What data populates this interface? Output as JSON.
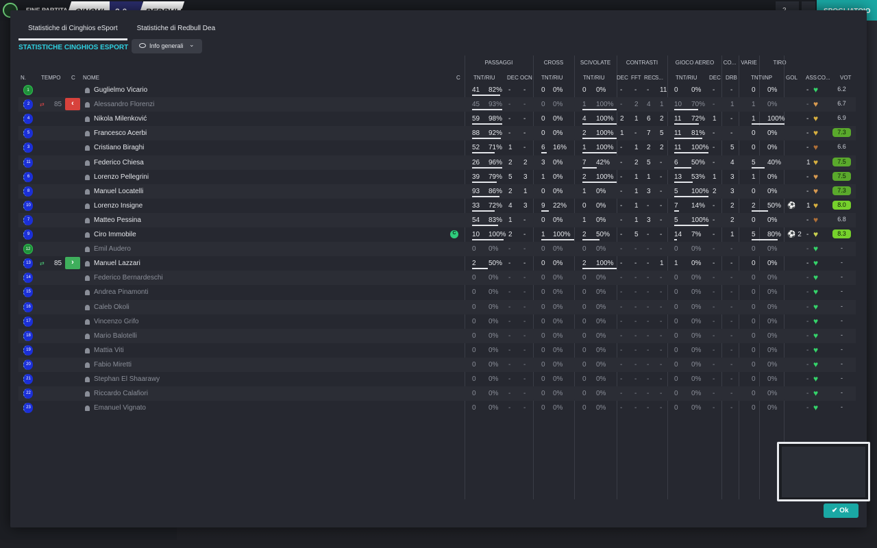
{
  "topbar": {
    "title": "FINE PARTITA",
    "team1": "CINGHI...",
    "score": "2-0",
    "team2": "REDBULL",
    "btn1": "2",
    "cta": "SPOGLIATOIO"
  },
  "modal": {
    "tabs": [
      "Statistiche di Cinghios eSport",
      "Statistiche di Redbull Dea"
    ],
    "section_title": "STATISTICHE CINGHIOS ESPORT",
    "dropdown": "Info generali",
    "ok_label": "Ok"
  },
  "headers": {
    "groups": [
      "PASSAGGI",
      "CROSS",
      "SCIVOLATE",
      "CONTRASTI",
      "GIOCO AEREO",
      "CO...",
      "VARIE",
      "TIRO"
    ],
    "cols": [
      "N.",
      "TEMPO",
      "C",
      "NOME",
      "C",
      "TNT/RIU",
      "DEC",
      "OCN",
      "TNT/RIU",
      "TNT/RIU",
      "DEC",
      "FFT",
      "REC",
      "S...",
      "TNT/RIU",
      "DEC",
      "DRB",
      "TNT\\INP",
      "GOL",
      "ASS",
      "CO...",
      "VOT"
    ]
  },
  "players": [
    {
      "n": "1",
      "name": "Guglielmo Vicario",
      "gk": true,
      "p": [
        "41",
        "82%"
      ],
      "dec": "-",
      "ocn": "-",
      "cr": [
        "0",
        "0%"
      ],
      "sc": [
        "0",
        "0%"
      ],
      "ct": [
        "-",
        "-",
        "-",
        "11"
      ],
      "ga": [
        "0",
        "0%"
      ],
      "co": "-",
      "drb": "-",
      "sh": [
        "0",
        "0%"
      ],
      "gol": "",
      "ass": "-",
      "vot": "6.2",
      "vs": "plain",
      "heart": "#35d46a",
      "bars": [
        0.9,
        0,
        0,
        0,
        0
      ]
    },
    {
      "n": "2",
      "name": "Alessandro Florenzi",
      "sub": "out",
      "time": "85",
      "p": [
        "45",
        "93%"
      ],
      "dec": "-",
      "ocn": "-",
      "cr": [
        "0",
        "0%"
      ],
      "sc": [
        "1",
        "100%"
      ],
      "ct": [
        "-",
        "2",
        "4",
        "1"
      ],
      "ga": [
        "10",
        "70%"
      ],
      "co": "-",
      "drb": "1",
      "sh": [
        "1",
        "0%"
      ],
      "gol": "",
      "ass": "-",
      "vot": "6.7",
      "vs": "plain",
      "heart": "#d89a50",
      "dim": true,
      "bars": [
        0.95,
        0,
        1,
        0.7,
        0
      ]
    },
    {
      "n": "4",
      "name": "Nikola Milenković",
      "p": [
        "59",
        "98%"
      ],
      "dec": "-",
      "ocn": "-",
      "cr": [
        "0",
        "0%"
      ],
      "sc": [
        "4",
        "100%"
      ],
      "ct": [
        "2",
        "1",
        "6",
        "2"
      ],
      "ga": [
        "11",
        "72%"
      ],
      "co": "1",
      "drb": "-",
      "sh": [
        "1",
        "100%"
      ],
      "gol": "",
      "ass": "-",
      "vot": "6.9",
      "vs": "plain",
      "heart": "#d8b040",
      "bars": [
        0.95,
        0,
        1,
        0.72,
        1
      ]
    },
    {
      "n": "5",
      "name": "Francesco Acerbi",
      "p": [
        "88",
        "92%"
      ],
      "dec": "-",
      "ocn": "-",
      "cr": [
        "0",
        "0%"
      ],
      "sc": [
        "2",
        "100%"
      ],
      "ct": [
        "1",
        "-",
        "7",
        "5"
      ],
      "ga": [
        "11",
        "81%"
      ],
      "co": "-",
      "drb": "-",
      "sh": [
        "0",
        "0%"
      ],
      "gol": "",
      "ass": "-",
      "vot": "7.3",
      "vs": "green",
      "heart": "#d8b040",
      "bars": [
        0.92,
        0,
        1,
        0.81,
        0
      ]
    },
    {
      "n": "3",
      "name": "Cristiano Biraghi",
      "p": [
        "52",
        "71%"
      ],
      "dec": "1",
      "ocn": "-",
      "cr": [
        "6",
        "16%"
      ],
      "sc": [
        "1",
        "100%"
      ],
      "ct": [
        "-",
        "1",
        "2",
        "2"
      ],
      "ga": [
        "11",
        "100%"
      ],
      "co": "-",
      "drb": "5",
      "sh": [
        "0",
        "0%"
      ],
      "gol": "",
      "ass": "-",
      "vot": "6.6",
      "vs": "plain",
      "heart": "#b07038",
      "bars": [
        0.71,
        0.16,
        1,
        1,
        0
      ]
    },
    {
      "n": "11",
      "name": "Federico Chiesa",
      "p": [
        "26",
        "96%"
      ],
      "dec": "2",
      "ocn": "2",
      "cr": [
        "3",
        "0%"
      ],
      "sc": [
        "7",
        "42%"
      ],
      "ct": [
        "-",
        "2",
        "5",
        "-"
      ],
      "ga": [
        "6",
        "50%"
      ],
      "co": "-",
      "drb": "4",
      "sh": [
        "5",
        "40%"
      ],
      "gol": "",
      "ass": "1",
      "vot": "7.5",
      "vs": "green",
      "heart": "#d8b040",
      "bars": [
        0.96,
        0,
        0.42,
        0.5,
        0.4
      ]
    },
    {
      "n": "6",
      "name": "Lorenzo Pellegrini",
      "p": [
        "39",
        "79%"
      ],
      "dec": "5",
      "ocn": "3",
      "cr": [
        "1",
        "0%"
      ],
      "sc": [
        "2",
        "100%"
      ],
      "ct": [
        "-",
        "1",
        "1",
        "-"
      ],
      "ga": [
        "13",
        "53%"
      ],
      "co": "1",
      "drb": "3",
      "sh": [
        "1",
        "0%"
      ],
      "gol": "",
      "ass": "-",
      "vot": "7.5",
      "vs": "green",
      "heart": "#d89a50",
      "bars": [
        0.79,
        0,
        1,
        0.53,
        0
      ]
    },
    {
      "n": "8",
      "name": "Manuel Locatelli",
      "p": [
        "93",
        "86%"
      ],
      "dec": "2",
      "ocn": "1",
      "cr": [
        "0",
        "0%"
      ],
      "sc": [
        "1",
        "0%"
      ],
      "ct": [
        "-",
        "1",
        "3",
        "-"
      ],
      "ga": [
        "5",
        "100%"
      ],
      "co": "2",
      "drb": "3",
      "sh": [
        "0",
        "0%"
      ],
      "gol": "",
      "ass": "-",
      "vot": "7.3",
      "vs": "green",
      "heart": "#d89a50",
      "bars": [
        0.86,
        0,
        0,
        1,
        0
      ]
    },
    {
      "n": "10",
      "name": "Lorenzo Insigne",
      "p": [
        "33",
        "72%"
      ],
      "dec": "4",
      "ocn": "3",
      "cr": [
        "9",
        "22%"
      ],
      "sc": [
        "0",
        "0%"
      ],
      "ct": [
        "-",
        "1",
        "-",
        "-"
      ],
      "ga": [
        "7",
        "14%"
      ],
      "co": "-",
      "drb": "2",
      "sh": [
        "2",
        "50%"
      ],
      "gol": "⚽",
      "ass": "1",
      "vot": "8.0",
      "vs": "bright",
      "heart": "#d8b040",
      "bars": [
        0.72,
        0.22,
        0,
        0.14,
        0.5
      ]
    },
    {
      "n": "7",
      "name": "Matteo Pessina",
      "p": [
        "54",
        "83%"
      ],
      "dec": "1",
      "ocn": "-",
      "cr": [
        "0",
        "0%"
      ],
      "sc": [
        "1",
        "0%"
      ],
      "ct": [
        "-",
        "1",
        "3",
        "-"
      ],
      "ga": [
        "5",
        "100%"
      ],
      "co": "-",
      "drb": "2",
      "sh": [
        "0",
        "0%"
      ],
      "gol": "",
      "ass": "-",
      "vot": "6.8",
      "vs": "plain",
      "heart": "#b07038",
      "bars": [
        0.83,
        0,
        0,
        1,
        0
      ]
    },
    {
      "n": "9",
      "name": "Ciro Immobile",
      "captain": "C",
      "p": [
        "10",
        "100%"
      ],
      "dec": "2",
      "ocn": "-",
      "cr": [
        "1",
        "100%"
      ],
      "sc": [
        "2",
        "50%"
      ],
      "ct": [
        "-",
        "5",
        "-",
        "-"
      ],
      "ga": [
        "14",
        "7%"
      ],
      "co": "-",
      "drb": "1",
      "sh": [
        "5",
        "80%"
      ],
      "gol": "⚽ 2",
      "ass": "-",
      "vot": "8.3",
      "vs": "bright",
      "heart": "#c8d050",
      "bars": [
        1,
        1,
        0.5,
        0.07,
        0.8
      ]
    },
    {
      "n": "12",
      "name": "Emil Audero",
      "gk": true,
      "unused": true,
      "p": [
        "0",
        "0%"
      ],
      "dec": "-",
      "ocn": "-",
      "cr": [
        "0",
        "0%"
      ],
      "sc": [
        "0",
        "0%"
      ],
      "ct": [
        "-",
        "-",
        "-",
        "-"
      ],
      "ga": [
        "0",
        "0%"
      ],
      "co": "-",
      "drb": "-",
      "sh": [
        "0",
        "0%"
      ],
      "gol": "",
      "ass": "-",
      "vot": "-",
      "vs": "plain",
      "heart": "#35d46a",
      "bars": [
        0,
        0,
        0,
        0,
        0
      ]
    },
    {
      "n": "13",
      "name": "Manuel Lazzari",
      "sub": "in",
      "time": "85",
      "p": [
        "2",
        "50%"
      ],
      "dec": "-",
      "ocn": "-",
      "cr": [
        "0",
        "0%"
      ],
      "sc": [
        "2",
        "100%"
      ],
      "ct": [
        "-",
        "-",
        "-",
        "1"
      ],
      "ga": [
        "1",
        "0%"
      ],
      "co": "-",
      "drb": "-",
      "sh": [
        "0",
        "0%"
      ],
      "gol": "",
      "ass": "-",
      "vot": "-",
      "vs": "plain",
      "heart": "#35d46a",
      "bars": [
        0.5,
        0,
        1,
        0,
        0
      ]
    },
    {
      "n": "14",
      "name": "Federico Bernardeschi",
      "unused": true,
      "p": [
        "0",
        "0%"
      ],
      "dec": "-",
      "ocn": "-",
      "cr": [
        "0",
        "0%"
      ],
      "sc": [
        "0",
        "0%"
      ],
      "ct": [
        "-",
        "-",
        "-",
        "-"
      ],
      "ga": [
        "0",
        "0%"
      ],
      "co": "-",
      "drb": "-",
      "sh": [
        "0",
        "0%"
      ],
      "gol": "",
      "ass": "-",
      "vot": "-",
      "vs": "plain",
      "heart": "#35d46a",
      "bars": [
        0,
        0,
        0,
        0,
        0
      ]
    },
    {
      "n": "15",
      "name": "Andrea Pinamonti",
      "unused": true,
      "p": [
        "0",
        "0%"
      ],
      "dec": "-",
      "ocn": "-",
      "cr": [
        "0",
        "0%"
      ],
      "sc": [
        "0",
        "0%"
      ],
      "ct": [
        "-",
        "-",
        "-",
        "-"
      ],
      "ga": [
        "0",
        "0%"
      ],
      "co": "-",
      "drb": "-",
      "sh": [
        "0",
        "0%"
      ],
      "gol": "",
      "ass": "-",
      "vot": "-",
      "vs": "plain",
      "heart": "#35d46a",
      "bars": [
        0,
        0,
        0,
        0,
        0
      ]
    },
    {
      "n": "16",
      "name": "Caleb Okoli",
      "unused": true,
      "p": [
        "0",
        "0%"
      ],
      "dec": "-",
      "ocn": "-",
      "cr": [
        "0",
        "0%"
      ],
      "sc": [
        "0",
        "0%"
      ],
      "ct": [
        "-",
        "-",
        "-",
        "-"
      ],
      "ga": [
        "0",
        "0%"
      ],
      "co": "-",
      "drb": "-",
      "sh": [
        "0",
        "0%"
      ],
      "gol": "",
      "ass": "-",
      "vot": "-",
      "vs": "plain",
      "heart": "#35d46a",
      "bars": [
        0,
        0,
        0,
        0,
        0
      ]
    },
    {
      "n": "17",
      "name": "Vincenzo Grifo",
      "unused": true,
      "p": [
        "0",
        "0%"
      ],
      "dec": "-",
      "ocn": "-",
      "cr": [
        "0",
        "0%"
      ],
      "sc": [
        "0",
        "0%"
      ],
      "ct": [
        "-",
        "-",
        "-",
        "-"
      ],
      "ga": [
        "0",
        "0%"
      ],
      "co": "-",
      "drb": "-",
      "sh": [
        "0",
        "0%"
      ],
      "gol": "",
      "ass": "-",
      "vot": "-",
      "vs": "plain",
      "heart": "#35d46a",
      "bars": [
        0,
        0,
        0,
        0,
        0
      ]
    },
    {
      "n": "18",
      "name": "Mario Balotelli",
      "unused": true,
      "p": [
        "0",
        "0%"
      ],
      "dec": "-",
      "ocn": "-",
      "cr": [
        "0",
        "0%"
      ],
      "sc": [
        "0",
        "0%"
      ],
      "ct": [
        "-",
        "-",
        "-",
        "-"
      ],
      "ga": [
        "0",
        "0%"
      ],
      "co": "-",
      "drb": "-",
      "sh": [
        "0",
        "0%"
      ],
      "gol": "",
      "ass": "-",
      "vot": "-",
      "vs": "plain",
      "heart": "#35d46a",
      "bars": [
        0,
        0,
        0,
        0,
        0
      ]
    },
    {
      "n": "19",
      "name": "Mattia Viti",
      "unused": true,
      "p": [
        "0",
        "0%"
      ],
      "dec": "-",
      "ocn": "-",
      "cr": [
        "0",
        "0%"
      ],
      "sc": [
        "0",
        "0%"
      ],
      "ct": [
        "-",
        "-",
        "-",
        "-"
      ],
      "ga": [
        "0",
        "0%"
      ],
      "co": "-",
      "drb": "-",
      "sh": [
        "0",
        "0%"
      ],
      "gol": "",
      "ass": "-",
      "vot": "-",
      "vs": "plain",
      "heart": "#35d46a",
      "bars": [
        0,
        0,
        0,
        0,
        0
      ]
    },
    {
      "n": "20",
      "name": "Fabio Miretti",
      "unused": true,
      "p": [
        "0",
        "0%"
      ],
      "dec": "-",
      "ocn": "-",
      "cr": [
        "0",
        "0%"
      ],
      "sc": [
        "0",
        "0%"
      ],
      "ct": [
        "-",
        "-",
        "-",
        "-"
      ],
      "ga": [
        "0",
        "0%"
      ],
      "co": "-",
      "drb": "-",
      "sh": [
        "0",
        "0%"
      ],
      "gol": "",
      "ass": "-",
      "vot": "-",
      "vs": "plain",
      "heart": "#35d46a",
      "bars": [
        0,
        0,
        0,
        0,
        0
      ]
    },
    {
      "n": "21",
      "name": "Stephan El Shaarawy",
      "unused": true,
      "p": [
        "0",
        "0%"
      ],
      "dec": "-",
      "ocn": "-",
      "cr": [
        "0",
        "0%"
      ],
      "sc": [
        "0",
        "0%"
      ],
      "ct": [
        "-",
        "-",
        "-",
        "-"
      ],
      "ga": [
        "0",
        "0%"
      ],
      "co": "-",
      "drb": "-",
      "sh": [
        "0",
        "0%"
      ],
      "gol": "",
      "ass": "-",
      "vot": "-",
      "vs": "plain",
      "heart": "#35d46a",
      "bars": [
        0,
        0,
        0,
        0,
        0
      ]
    },
    {
      "n": "22",
      "name": "Riccardo Calafiori",
      "unused": true,
      "p": [
        "0",
        "0%"
      ],
      "dec": "-",
      "ocn": "-",
      "cr": [
        "0",
        "0%"
      ],
      "sc": [
        "0",
        "0%"
      ],
      "ct": [
        "-",
        "-",
        "-",
        "-"
      ],
      "ga": [
        "0",
        "0%"
      ],
      "co": "-",
      "drb": "-",
      "sh": [
        "0",
        "0%"
      ],
      "gol": "",
      "ass": "-",
      "vot": "-",
      "vs": "plain",
      "heart": "#35d46a",
      "bars": [
        0,
        0,
        0,
        0,
        0
      ]
    },
    {
      "n": "23",
      "name": "Emanuel Vignato",
      "unused": true,
      "p": [
        "0",
        "0%"
      ],
      "dec": "-",
      "ocn": "-",
      "cr": [
        "0",
        "0%"
      ],
      "sc": [
        "0",
        "0%"
      ],
      "ct": [
        "-",
        "-",
        "-",
        "-"
      ],
      "ga": [
        "0",
        "0%"
      ],
      "co": "-",
      "drb": "-",
      "sh": [
        "0",
        "0%"
      ],
      "gol": "",
      "ass": "-",
      "vot": "-",
      "vs": "plain",
      "heart": "#35d46a",
      "bars": [
        0,
        0,
        0,
        0,
        0
      ]
    }
  ]
}
